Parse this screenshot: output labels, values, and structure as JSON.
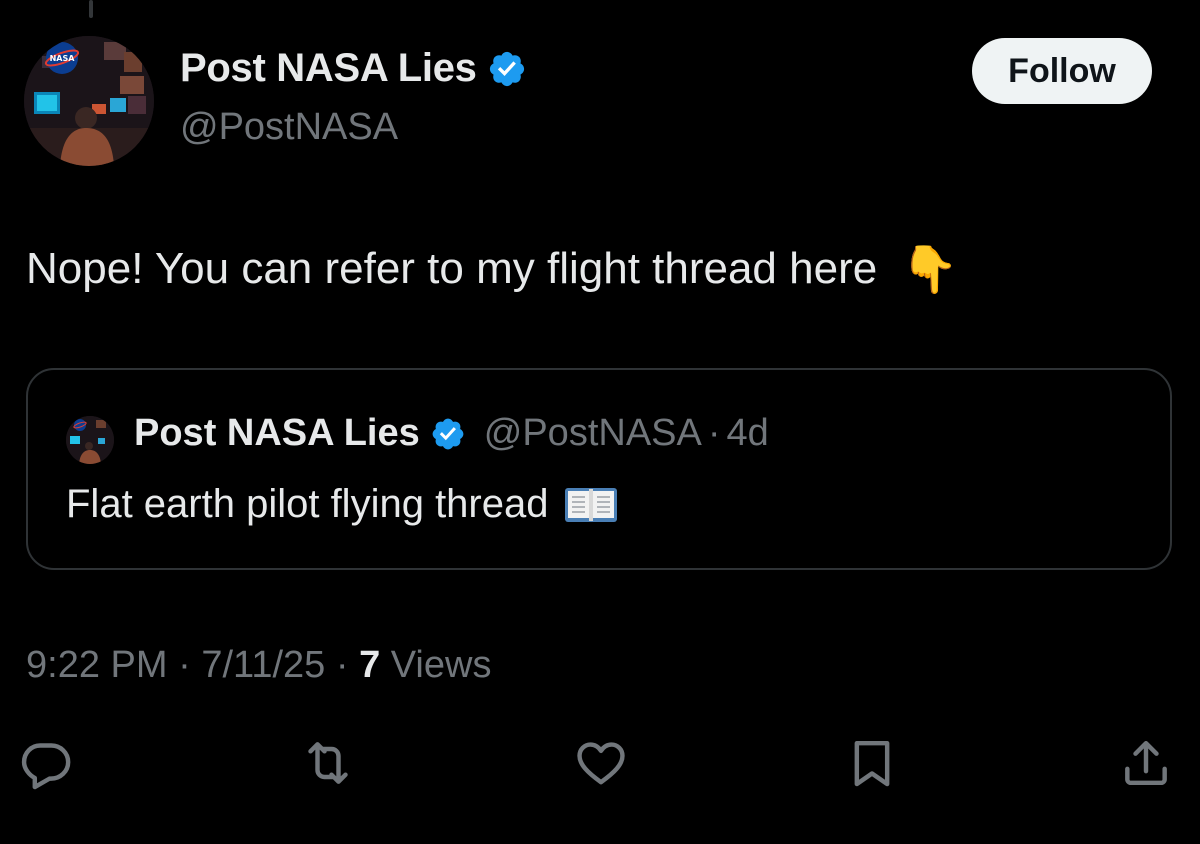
{
  "author": {
    "display_name": "Post NASA Lies",
    "handle": "@PostNASA",
    "avatar_icon": "nasa-desk-avatar",
    "verified_color": "#1d9bf0"
  },
  "follow_button": {
    "label": "Follow"
  },
  "tweet": {
    "text": "Nope! You can refer to my flight thread here",
    "emoji": "👇"
  },
  "quoted_tweet": {
    "display_name": "Post NASA Lies",
    "handle": "@PostNASA",
    "separator": "·",
    "age": "4d",
    "text": "Flat earth pilot flying thread",
    "emoji_icon": "open-book-icon"
  },
  "meta": {
    "time": "9:22 PM",
    "separator1": " · ",
    "date": "7/11/25",
    "separator2": " · ",
    "views_count": "7",
    "views_label": " Views"
  },
  "actions": [
    {
      "name": "reply",
      "icon": "reply-icon"
    },
    {
      "name": "repost",
      "icon": "repost-icon"
    },
    {
      "name": "like",
      "icon": "heart-icon"
    },
    {
      "name": "bookmark",
      "icon": "bookmark-icon"
    },
    {
      "name": "share",
      "icon": "share-icon"
    }
  ],
  "colors": {
    "background": "#000000",
    "text_primary": "#e7e9ea",
    "text_secondary": "#71767b",
    "border": "#2f3336",
    "verified": "#1d9bf0"
  }
}
